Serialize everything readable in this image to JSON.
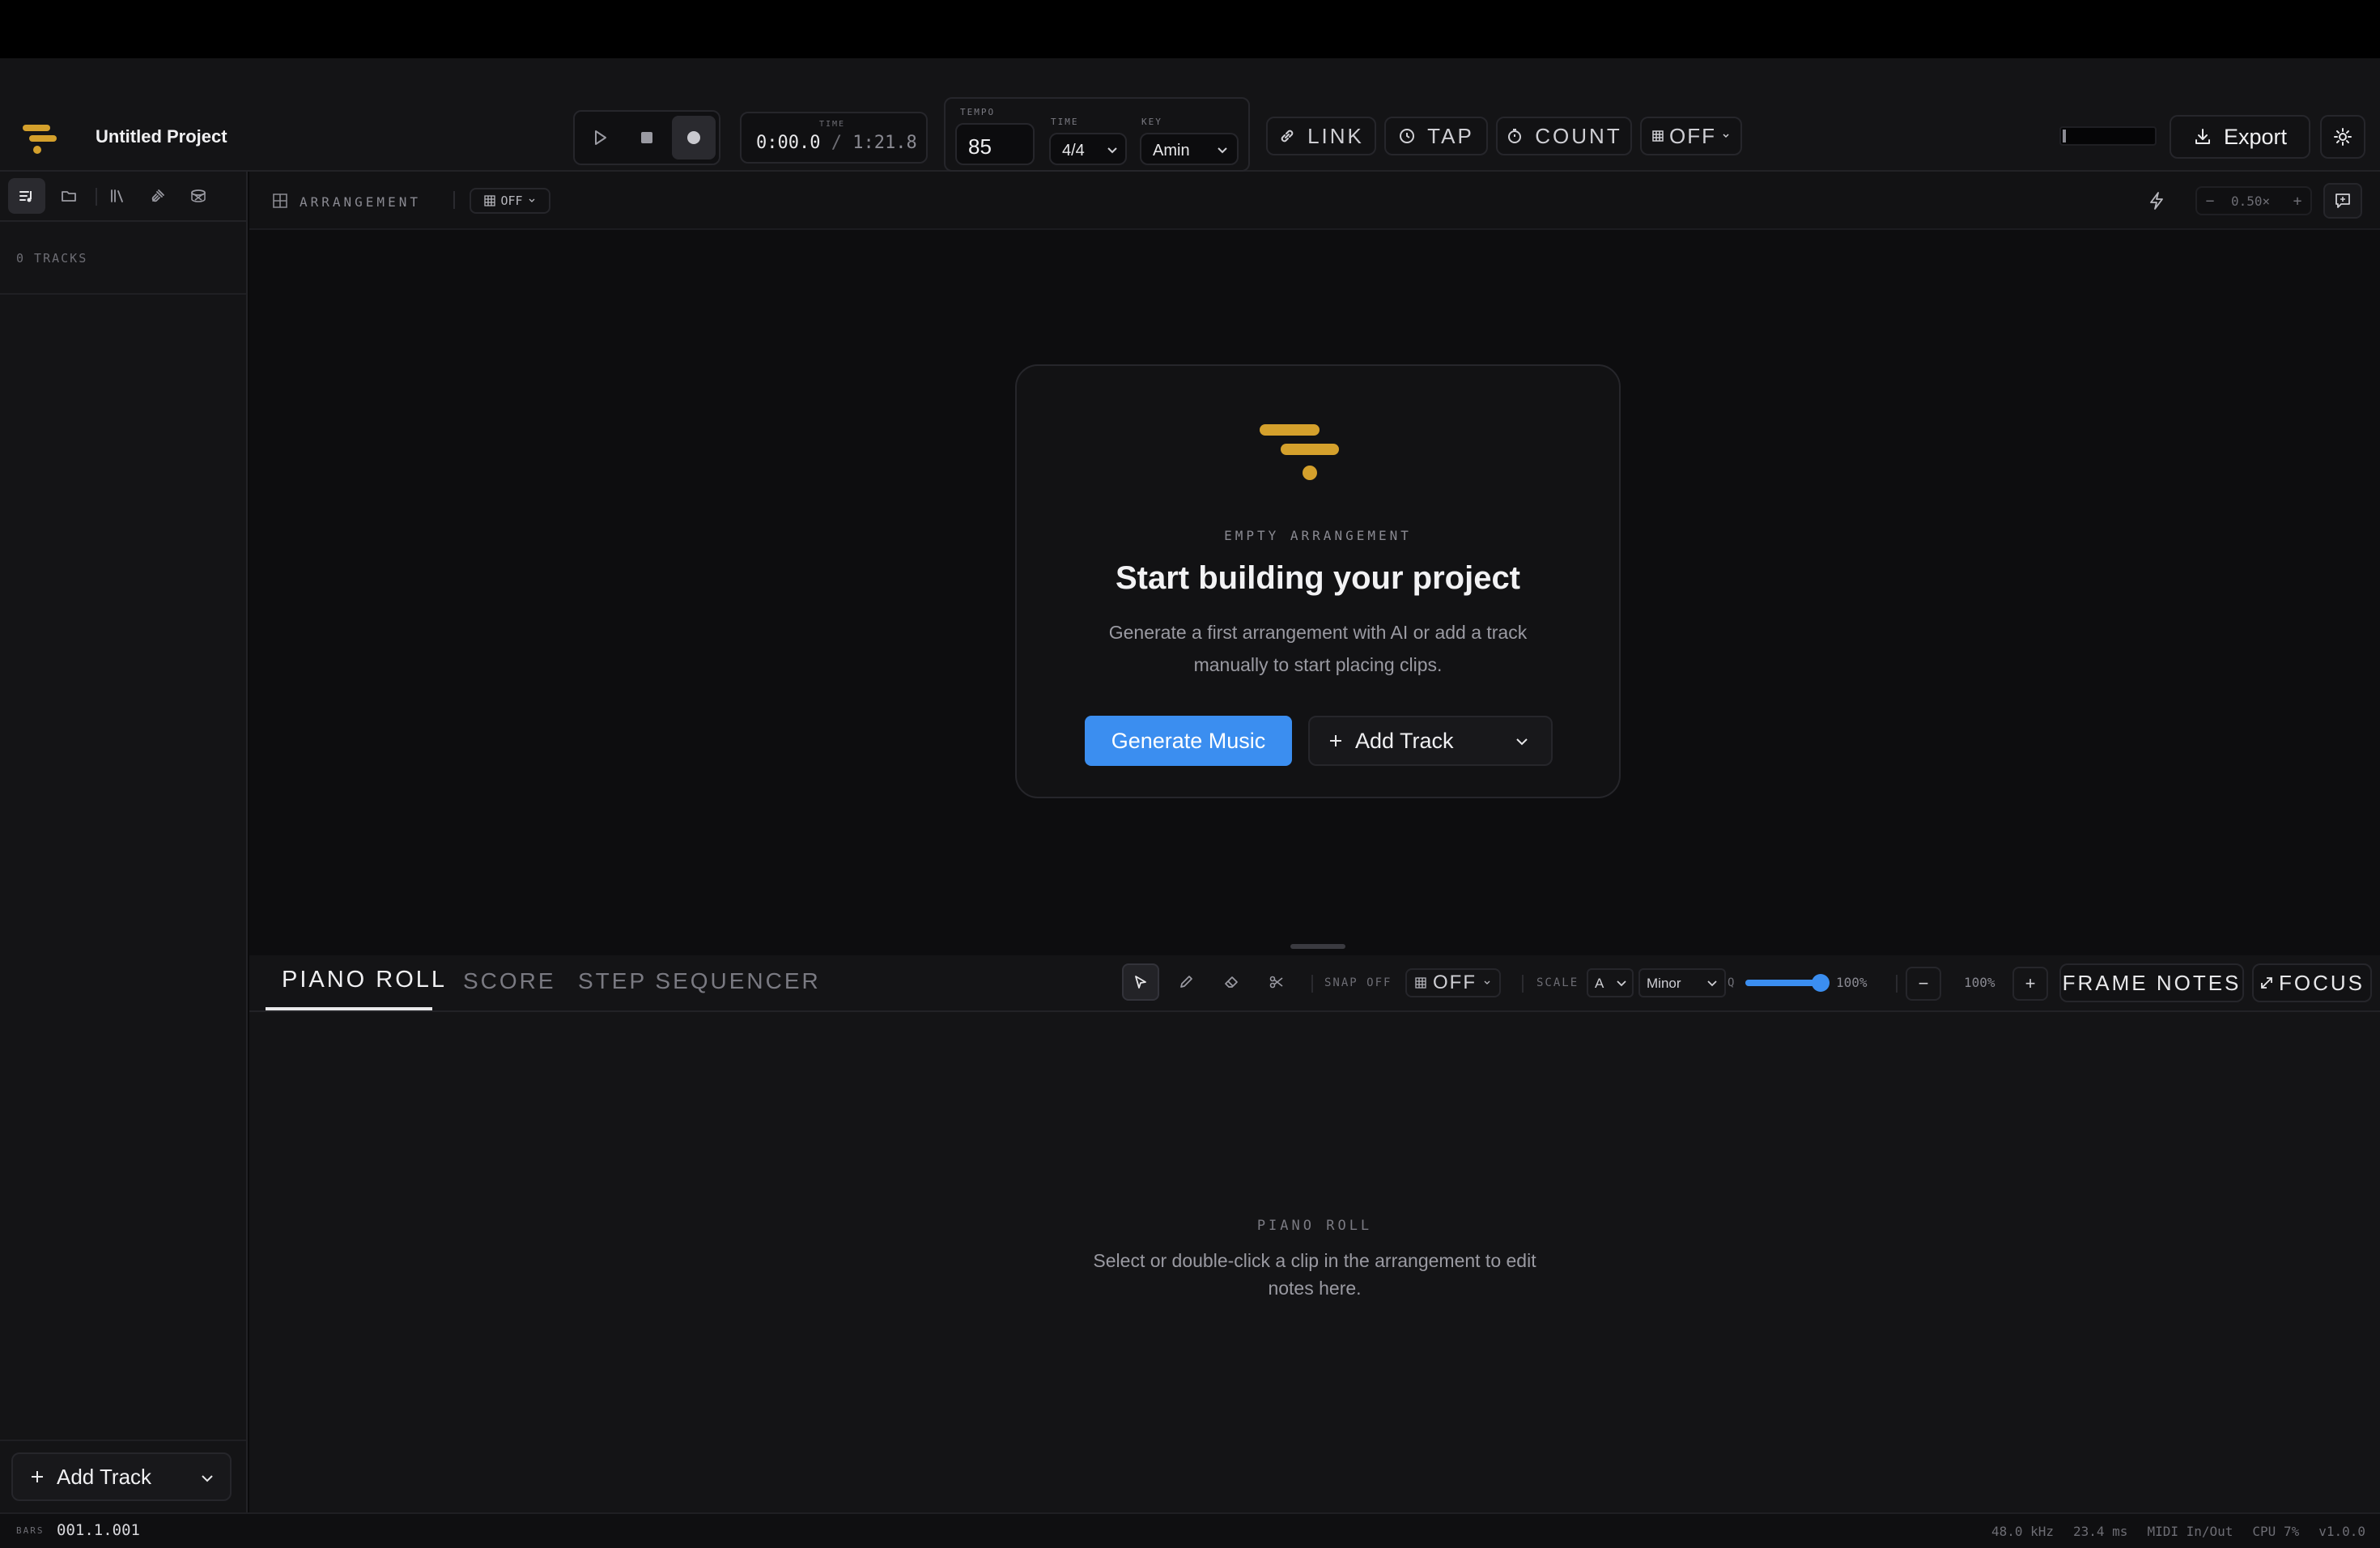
{
  "app": {
    "project_title": "Untitled Project",
    "brand_color": "#d4a02c",
    "accent_color": "#3b8ef0"
  },
  "transport": {
    "time_label": "TIME",
    "time_current": "0:00.0",
    "time_separator": "/",
    "time_total": "1:21.8",
    "tempo_label": "TEMPO",
    "tempo_value": "85",
    "signature_label": "TIME",
    "signature_value": "4/4",
    "key_label": "KEY",
    "key_value": "Amin",
    "link_label": "LINK",
    "tap_label": "TAP",
    "count_label": "COUNT",
    "metronome_value": "OFF"
  },
  "header": {
    "export_label": "Export"
  },
  "sidebar": {
    "tracks_label": "0 TRACKS",
    "add_track_label": "Add Track"
  },
  "arrangement": {
    "title": "ARRANGEMENT",
    "snap_value": "OFF",
    "zoom_value": "0.50×",
    "zoom_minus": "−",
    "zoom_plus": "+",
    "empty_eyebrow": "EMPTY ARRANGEMENT",
    "empty_title": "Start building your project",
    "empty_body_line1": "Generate a first arrangement with AI or add a track",
    "empty_body_line2": "manually to start placing clips.",
    "generate_label": "Generate Music",
    "add_track_label": "Add Track"
  },
  "editor": {
    "tabs": [
      "PIANO ROLL",
      "SCORE",
      "STEP SEQUENCER"
    ],
    "active_tab": 0,
    "snap_label": "SNAP OFF",
    "snap_value": "OFF",
    "scale_label": "SCALE",
    "scale_root": "A",
    "scale_mode": "Minor",
    "quantize_label": "Q",
    "quantize_value": "100%",
    "quantize_fraction": 1.0,
    "zoom_minus": "−",
    "zoom_value": "100%",
    "zoom_plus": "+",
    "frame_notes_label": "FRAME NOTES",
    "focus_label": "FOCUS",
    "empty_eyebrow": "PIANO ROLL",
    "empty_body_line1": "Select or double-click a clip in the arrangement to edit",
    "empty_body_line2": "notes here."
  },
  "status": {
    "bars_label": "BARS",
    "position": "001.1.001",
    "sample_rate": "48.0 kHz",
    "latency": "23.4 ms",
    "midi": "MIDI In/Out",
    "cpu": "CPU 7%",
    "version": "v1.0.0"
  },
  "icons": [
    "logo-icon",
    "play-icon",
    "stop-icon",
    "record-icon",
    "link-icon",
    "tap-clock-icon",
    "count-timer-icon",
    "grid-icon",
    "download-icon",
    "gear-icon",
    "tracks-icon",
    "folder-icon",
    "library-icon",
    "plugin-icon",
    "drum-icon",
    "lightning-icon",
    "comment-icon",
    "pointer-icon",
    "pencil-icon",
    "eraser-icon",
    "scissors-icon",
    "chevron-down-icon",
    "plus-icon",
    "expand-icon"
  ]
}
